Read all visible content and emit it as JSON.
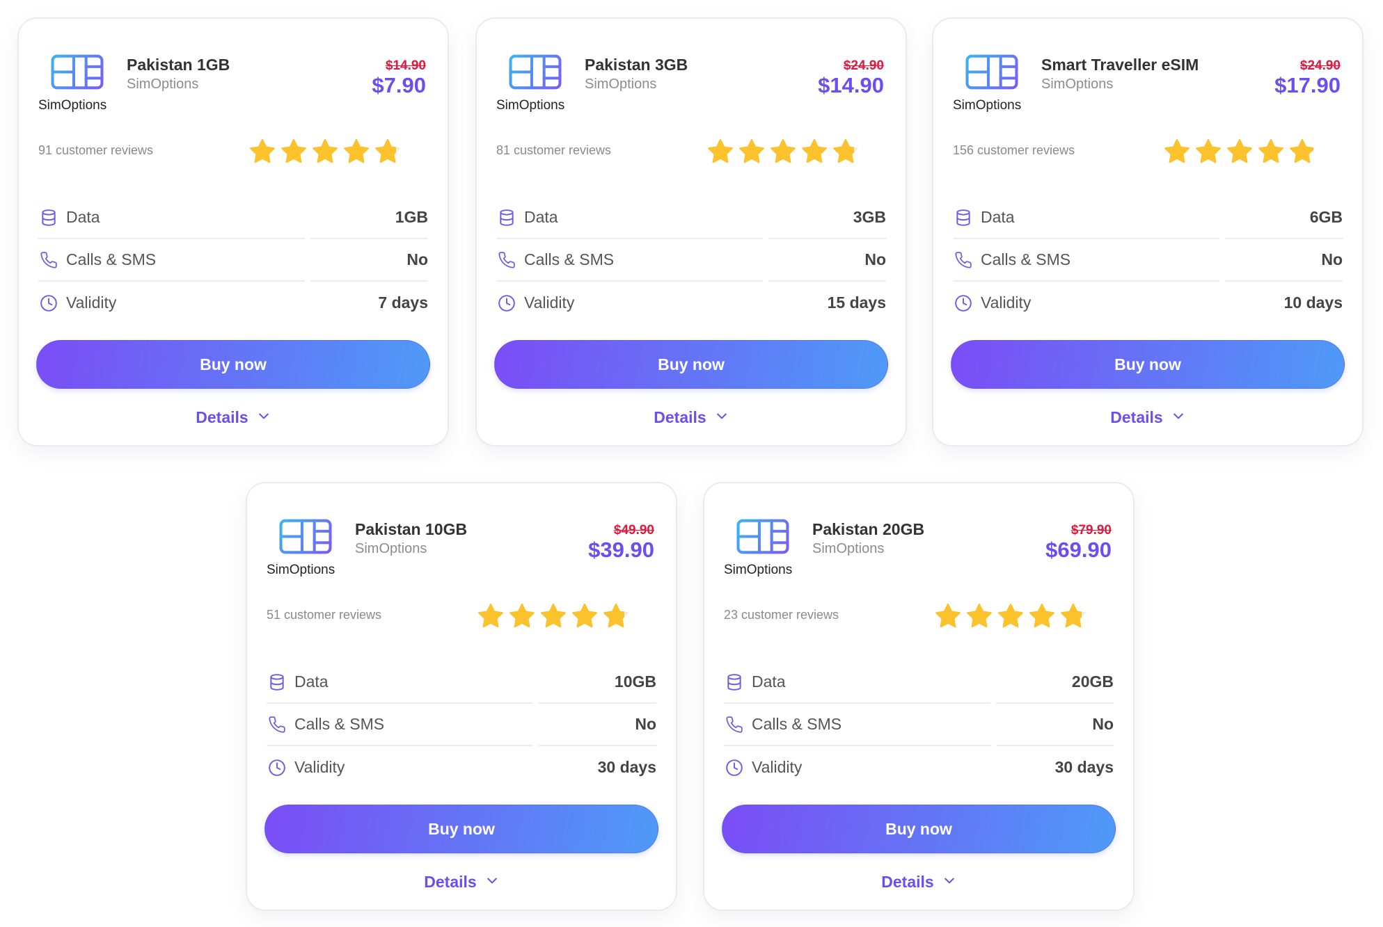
{
  "colors": {
    "accent": "#6b4ef0",
    "old_price": "#e0193f",
    "button_start": "#7b4df6",
    "button_end": "#4e9af7",
    "star": "#fbc22b",
    "icon": "#6c5ce7"
  },
  "products": [
    {
      "logo_icon": "sim-card-icon",
      "logo_text": "SimOptions",
      "title": "Pakistan 1GB",
      "provider": "SimOptions",
      "old_price": "$14.90",
      "price": "$7.90",
      "reviews": "91 customer reviews",
      "rating": 4.8,
      "specs": [
        {
          "icon": "database-icon",
          "label": "Data",
          "value": "1GB"
        },
        {
          "icon": "phone-icon",
          "label": "Calls & SMS",
          "value": "No"
        },
        {
          "icon": "clock-icon",
          "label": "Validity",
          "value": "7 days"
        }
      ],
      "buy_label": "Buy now",
      "details_label": "Details",
      "details_icon": "chevron-down-icon"
    },
    {
      "logo_icon": "sim-card-icon",
      "logo_text": "SimOptions",
      "title": "Pakistan 3GB",
      "provider": "SimOptions",
      "old_price": "$24.90",
      "price": "$14.90",
      "reviews": "81 customer reviews",
      "rating": 4.8,
      "specs": [
        {
          "icon": "database-icon",
          "label": "Data",
          "value": "3GB"
        },
        {
          "icon": "phone-icon",
          "label": "Calls & SMS",
          "value": "No"
        },
        {
          "icon": "clock-icon",
          "label": "Validity",
          "value": "15 days"
        }
      ],
      "buy_label": "Buy now",
      "details_label": "Details",
      "details_icon": "chevron-down-icon"
    },
    {
      "logo_icon": "sim-card-icon",
      "logo_text": "SimOptions",
      "title": "Smart Traveller eSIM",
      "provider": "SimOptions",
      "old_price": "$24.90",
      "price": "$17.90",
      "reviews": "156 customer reviews",
      "rating": 4.9,
      "specs": [
        {
          "icon": "database-icon",
          "label": "Data",
          "value": "6GB"
        },
        {
          "icon": "phone-icon",
          "label": "Calls & SMS",
          "value": "No"
        },
        {
          "icon": "clock-icon",
          "label": "Validity",
          "value": "10 days"
        }
      ],
      "buy_label": "Buy now",
      "details_label": "Details",
      "details_icon": "chevron-down-icon"
    },
    {
      "logo_icon": "sim-card-icon",
      "logo_text": "SimOptions",
      "title": "Pakistan 10GB",
      "provider": "SimOptions",
      "old_price": "$49.90",
      "price": "$39.90",
      "reviews": "51 customer reviews",
      "rating": 4.8,
      "specs": [
        {
          "icon": "database-icon",
          "label": "Data",
          "value": "10GB"
        },
        {
          "icon": "phone-icon",
          "label": "Calls & SMS",
          "value": "No"
        },
        {
          "icon": "clock-icon",
          "label": "Validity",
          "value": "30 days"
        }
      ],
      "buy_label": "Buy now",
      "details_label": "Details",
      "details_icon": "chevron-down-icon"
    },
    {
      "logo_icon": "sim-card-icon",
      "logo_text": "SimOptions",
      "title": "Pakistan 20GB",
      "provider": "SimOptions",
      "old_price": "$79.90",
      "price": "$69.90",
      "reviews": "23 customer reviews",
      "rating": 4.8,
      "specs": [
        {
          "icon": "database-icon",
          "label": "Data",
          "value": "20GB"
        },
        {
          "icon": "phone-icon",
          "label": "Calls & SMS",
          "value": "No"
        },
        {
          "icon": "clock-icon",
          "label": "Validity",
          "value": "30 days"
        }
      ],
      "buy_label": "Buy now",
      "details_label": "Details",
      "details_icon": "chevron-down-icon"
    }
  ]
}
